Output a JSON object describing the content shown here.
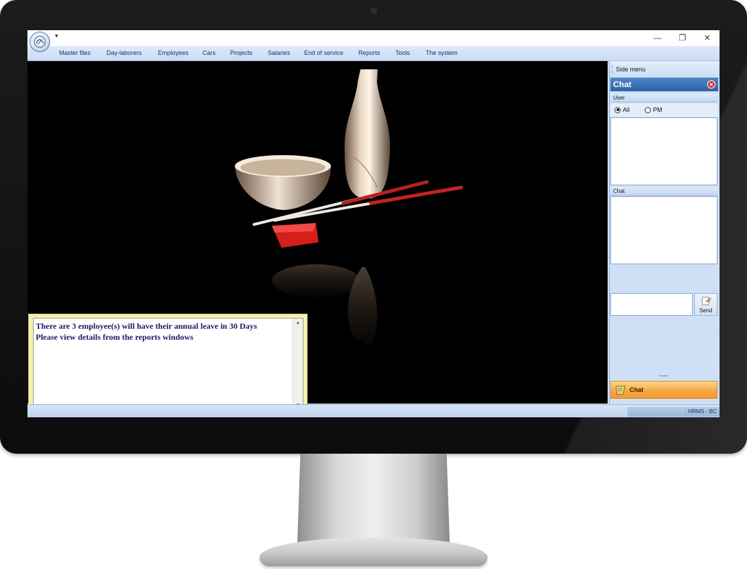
{
  "titlebar": {
    "quick_access": "▾",
    "minimize": "—",
    "restore": "❐",
    "close": "✕"
  },
  "menu": [
    "Master files",
    "Day-laborers",
    "Employees",
    "Cars",
    "Projects",
    "Salaries",
    "End of service",
    "Reports",
    "Tools",
    "The system"
  ],
  "notification": {
    "line1": "There are 3 employee(s) will have their annual leave in 30 Days",
    "line2": "Please view details from the  reports windows"
  },
  "side_menu": {
    "title": "Side menu",
    "chat_title": "Chat",
    "user_label": "User",
    "radio_all": "All",
    "radio_pm": "PM",
    "selected": "All",
    "chat_label": "Chat",
    "send_label": "Send",
    "tab_label": "Chat"
  },
  "status": {
    "text": ": HRMS - BC"
  },
  "colors": {
    "accent": "#2e62a6",
    "menu_bg": "#c9dbf3",
    "chat_tab": "#f6a844",
    "notification_border": "#f4f1b0"
  }
}
